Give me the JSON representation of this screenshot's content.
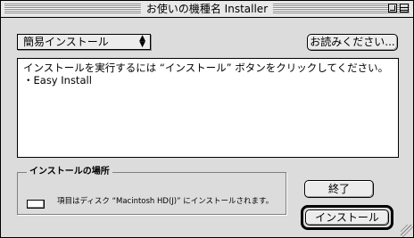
{
  "window": {
    "title": "お使いの機種名 Installer"
  },
  "popup": {
    "selected": "簡易インストール",
    "arrows_up": "▲",
    "arrows_down": "▼"
  },
  "buttons": {
    "readme": "お読みください...",
    "quit": "終了",
    "install": "インストール"
  },
  "description": {
    "line1": "インストールを実行するには “インストール” ボタンをクリックしてください。",
    "line2": "・Easy Install"
  },
  "install_location": {
    "title": "インストールの場所",
    "info": "項目はディスク “Macintosh HD(J)” にインストールされます。"
  },
  "colors": {
    "window_bg": "#dcdcdc",
    "text_area_bg": "#ffffff",
    "border": "#000000"
  }
}
